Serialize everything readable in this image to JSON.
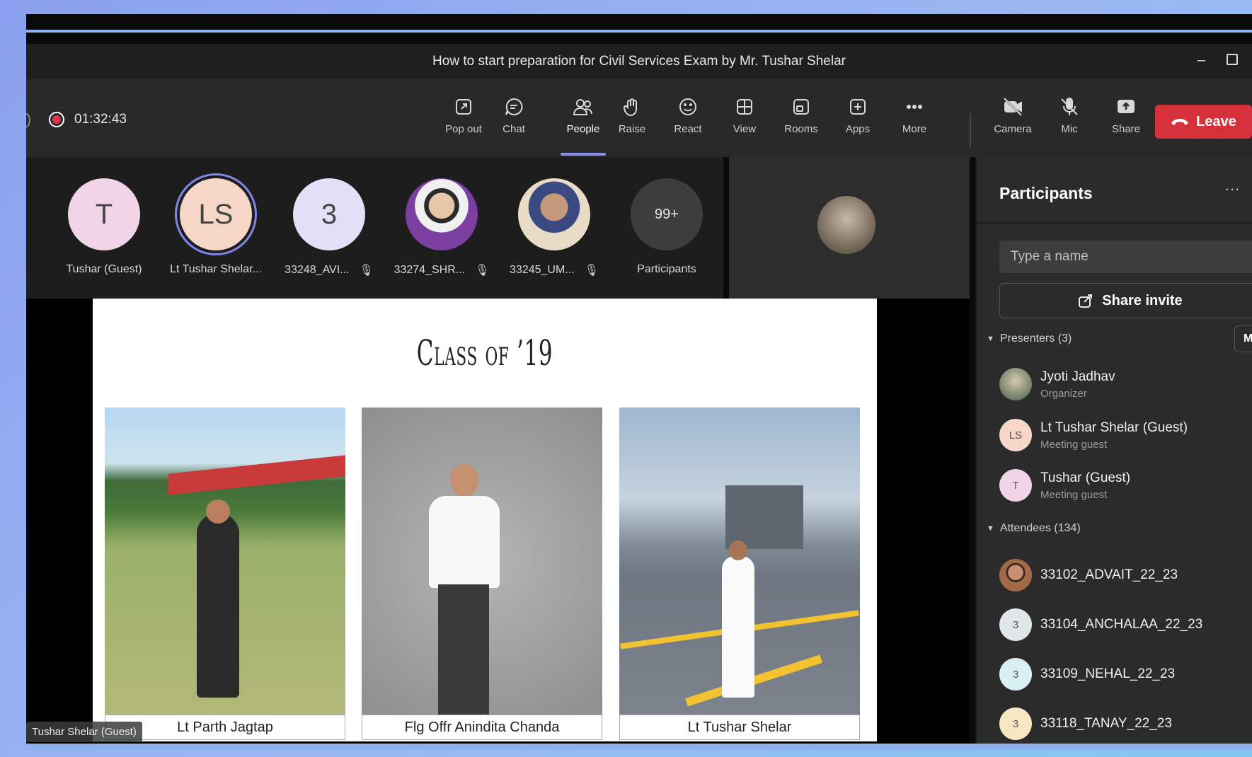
{
  "window": {
    "title": "How to start preparation for Civil Services Exam by Mr. Tushar Shelar",
    "minimize_glyph": "–"
  },
  "toolbar": {
    "timer": "01:32:43",
    "buttons": [
      {
        "label": "Pop out",
        "icon": "popout-icon"
      },
      {
        "label": "Chat",
        "icon": "chat-icon"
      },
      {
        "label": "People",
        "icon": "people-icon"
      },
      {
        "label": "Raise",
        "icon": "hand-icon"
      },
      {
        "label": "React",
        "icon": "smiley-icon"
      },
      {
        "label": "View",
        "icon": "grid-icon"
      },
      {
        "label": "Rooms",
        "icon": "rooms-icon"
      },
      {
        "label": "Apps",
        "icon": "apps-plus-icon"
      },
      {
        "label": "More",
        "icon": "more-dots-icon"
      },
      {
        "label": "Camera",
        "icon": "camera-off-icon"
      },
      {
        "label": "Mic",
        "icon": "mic-off-icon"
      },
      {
        "label": "Share",
        "icon": "share-screen-icon"
      }
    ],
    "leave_label": "Leave",
    "accent": "#d6313b"
  },
  "strip": {
    "tiles": [
      {
        "initials": "T",
        "name": "Tushar (Guest)",
        "bg": "#f2d4e8",
        "muted": false
      },
      {
        "initials": "LS",
        "name": "Lt Tushar Shelar...",
        "bg": "#f6d6c6",
        "muted": false
      },
      {
        "initials": "3",
        "name": "33248_AVI...",
        "bg": "#e2e0f6",
        "muted": true
      },
      {
        "initials": "",
        "name": "33274_SHR...",
        "bg": "#7a3fa0",
        "muted": true
      },
      {
        "initials": "",
        "name": "33245_UM...",
        "bg": "#d8c6a6",
        "muted": true
      },
      {
        "initials": "99+",
        "name": "Participants",
        "bg": "#3d3d3d",
        "muted": false
      }
    ],
    "mute_glyph": "🎙"
  },
  "slide": {
    "title": "Class of ’19",
    "captions": [
      "Lt Parth Jagtap",
      "Flg Offr Anindita Chanda",
      "Lt Tushar Shelar"
    ],
    "speaker_label": "Tushar Shelar (Guest)"
  },
  "panel": {
    "title": "Participants",
    "more_glyph": "···",
    "search_placeholder": "Type a name",
    "share_invite_label": "Share invite",
    "presenters_heading": "Presenters (3)",
    "mute_label": "Mute",
    "presenters": [
      {
        "initials": "",
        "name": "Jyoti Jadhav",
        "role": "Organizer",
        "bg": "#8a9a80"
      },
      {
        "initials": "LS",
        "name": "Lt Tushar Shelar (Guest)",
        "role": "Meeting guest",
        "bg": "#f6d6c6"
      },
      {
        "initials": "T",
        "name": "Tushar (Guest)",
        "role": "Meeting guest",
        "bg": "#f2d4e8"
      }
    ],
    "attendees_heading": "Attendees (134)",
    "attendees": [
      {
        "initials": "",
        "name": "33102_ADVAIT_22_23",
        "bg": "#a36a4a"
      },
      {
        "initials": "3",
        "name": "33104_ANCHALAA_22_23",
        "bg": "#dfe7e8"
      },
      {
        "initials": "3",
        "name": "33109_NEHAL_22_23",
        "bg": "#d8f0f4"
      },
      {
        "initials": "3",
        "name": "33118_TANAY_22_23",
        "bg": "#f6e6c4"
      }
    ]
  }
}
